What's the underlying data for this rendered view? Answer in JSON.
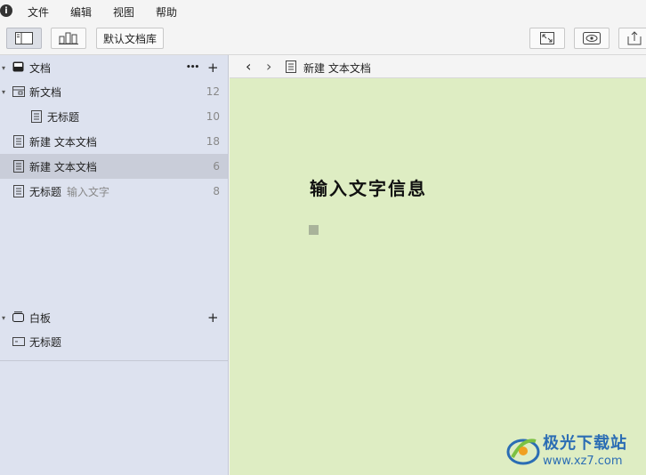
{
  "menubar": {
    "items": [
      "文件",
      "编辑",
      "视图",
      "帮助"
    ]
  },
  "toolbar": {
    "library_label": "默认文档库"
  },
  "sidebar": {
    "documents_section": {
      "title": "文档",
      "more": "•••",
      "add": "+"
    },
    "rows": [
      {
        "label": "新文档",
        "count": "12",
        "sub": ""
      },
      {
        "label": "无标题",
        "count": "10",
        "sub": ""
      },
      {
        "label": "新建 文本文档",
        "count": "18",
        "sub": ""
      },
      {
        "label": "新建 文本文档",
        "count": "6",
        "sub": ""
      },
      {
        "label": "无标题",
        "count": "8",
        "sub": "输入文字"
      }
    ],
    "whiteboard_section": {
      "title": "白板",
      "add": "+"
    },
    "whiteboard_rows": [
      {
        "label": "无标题"
      }
    ]
  },
  "editor": {
    "breadcrumb_title": "新建 文本文档",
    "back": "‹",
    "forward": "›",
    "heading": "输入文字信息"
  },
  "watermark": {
    "title": "极光下载站",
    "url": "www.xz7.com"
  }
}
